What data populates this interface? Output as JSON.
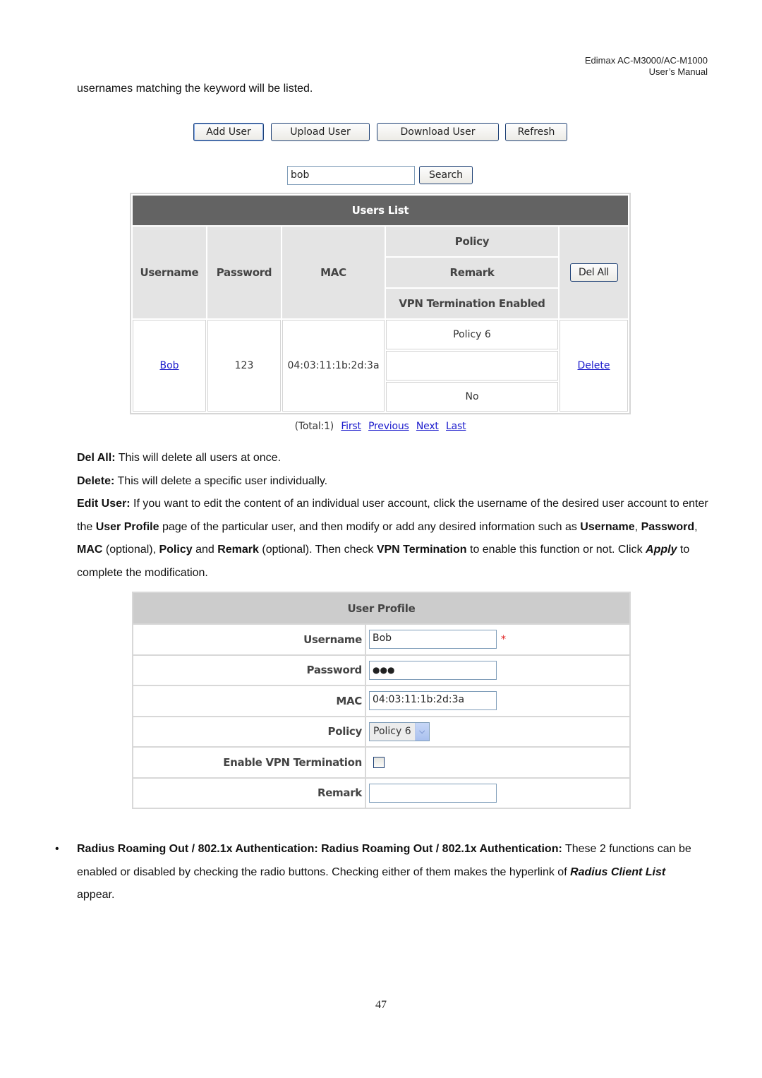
{
  "header": {
    "product": "Edimax  AC-M3000/AC-M1000",
    "manual": "User’s  Manual"
  },
  "intro_text": "usernames matching the keyword will be listed.",
  "users_screen": {
    "buttons": {
      "add_user": "Add User",
      "upload_user": "Upload User",
      "download_user": "Download User",
      "refresh": "Refresh"
    },
    "search": {
      "value": "bob",
      "button": "Search"
    },
    "table": {
      "title": "Users List",
      "headers": {
        "username": "Username",
        "password": "Password",
        "mac": "MAC",
        "policy": "Policy",
        "remark": "Remark",
        "vpn": "VPN Termination Enabled",
        "del_all": "Del All"
      },
      "rows": [
        {
          "username": "Bob",
          "password": "123",
          "mac": "04:03:11:1b:2d:3a",
          "policy": "Policy 6",
          "remark": "",
          "vpn": "No",
          "action": "Delete"
        }
      ]
    },
    "pager": {
      "total": "(Total:1)",
      "first": "First",
      "previous": "Previous",
      "next": "Next",
      "last": "Last"
    }
  },
  "descriptions": {
    "del_all_label": "Del All:",
    "del_all_text": " This will delete all users at once.",
    "delete_label": "Delete:",
    "delete_text": " This will delete a specific user individually.",
    "edit_user_label": "Edit User:",
    "edit_user_t1": " If you want to edit the content of an individual user account, click the username of the desired user account to enter the ",
    "edit_user_b1": "User Profile",
    "edit_user_t2": " page of the particular user, and then modify or add any desired information such as ",
    "edit_user_b2": "Username",
    "edit_user_t3": ", ",
    "edit_user_b3": "Password",
    "edit_user_t4": ", ",
    "edit_user_b4": "MAC",
    "edit_user_t5": " (optional), ",
    "edit_user_b5": "Policy",
    "edit_user_t6": " and ",
    "edit_user_b6": "Remark",
    "edit_user_t7": " (optional). Then check ",
    "edit_user_b7": "VPN Termination",
    "edit_user_t8": " to enable this function or not. Click ",
    "edit_user_b8": "Apply",
    "edit_user_t9": " to complete the modification."
  },
  "profile_screen": {
    "title": "User Profile",
    "fields": {
      "username_label": "Username",
      "username_value": "Bob",
      "required_mark": "*",
      "password_label": "Password",
      "password_value": "●●●",
      "mac_label": "MAC",
      "mac_value": "04:03:11:1b:2d:3a",
      "policy_label": "Policy",
      "policy_value": "Policy 6",
      "vpn_label": "Enable VPN Termination",
      "vpn_checked": false,
      "remark_label": "Remark",
      "remark_value": ""
    }
  },
  "bullet": {
    "symbol": "•",
    "bold": "Radius Roaming Out / 802.1x Authentication: Radius Roaming Out / 802.1x Authentication:",
    "t1": " These 2 functions can be enabled or disabled by checking the radio buttons. Checking either of them makes the hyperlink of ",
    "bi": "Radius Client List",
    "t2": " appear."
  },
  "page_number": "47",
  "colors": {
    "table_title_bg": "#636363",
    "header_bg": "#e4e4e4",
    "profile_title_bg": "#cccccc",
    "link": "#1a1acc",
    "required": "#e02020"
  }
}
